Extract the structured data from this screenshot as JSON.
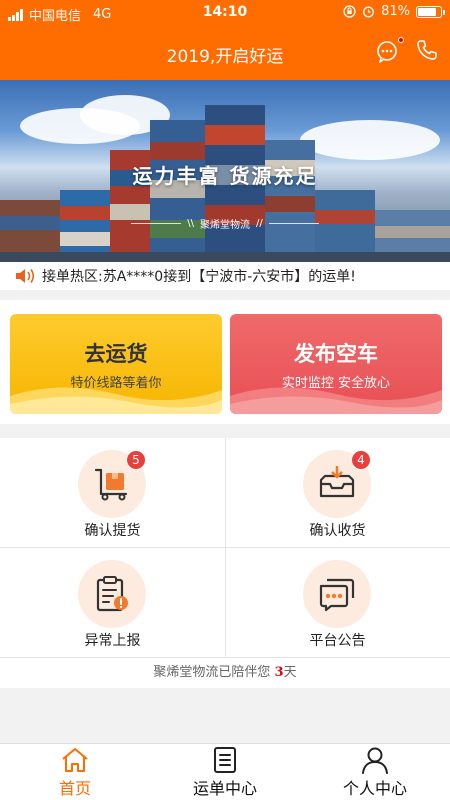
{
  "status": {
    "carrier": "中国电信",
    "network": "4G",
    "time": "14:10",
    "battery": "81%",
    "battery_level": 0.81
  },
  "header": {
    "title": "2019,开启好运",
    "icons": [
      "message-icon",
      "phone-icon"
    ]
  },
  "banner": {
    "slogan": "运力丰富  货源充足",
    "brand": "聚烯堂物流"
  },
  "ticker": {
    "text": "接单热区:苏A****0接到【宁波市-六安市】的运单!"
  },
  "actions": {
    "ship": {
      "title": "去运货",
      "subtitle": "特价线路等着你"
    },
    "publish": {
      "title": "发布空车",
      "subtitle": "实时监控 安全放心"
    }
  },
  "grid": {
    "items": [
      {
        "label": "确认提货",
        "badge": "5",
        "icon": "pickup-cart-icon"
      },
      {
        "label": "确认收货",
        "badge": "4",
        "icon": "receive-box-icon"
      },
      {
        "label": "异常上报",
        "icon": "exception-report-icon"
      },
      {
        "label": "平台公告",
        "icon": "announcement-icon"
      }
    ]
  },
  "company_note": {
    "prefix": "聚烯堂物流已陪伴您 ",
    "days": "3",
    "suffix": "天"
  },
  "tabs": [
    {
      "label": "首页",
      "active": true,
      "icon": "home-icon"
    },
    {
      "label": "运单中心",
      "active": false,
      "icon": "waybill-icon"
    },
    {
      "label": "个人中心",
      "active": false,
      "icon": "user-icon"
    }
  ],
  "colors": {
    "primary": "#ff6c00",
    "ship_card": "#f6b500",
    "publish_card": "#e74f55",
    "badge": "#e8403c"
  }
}
